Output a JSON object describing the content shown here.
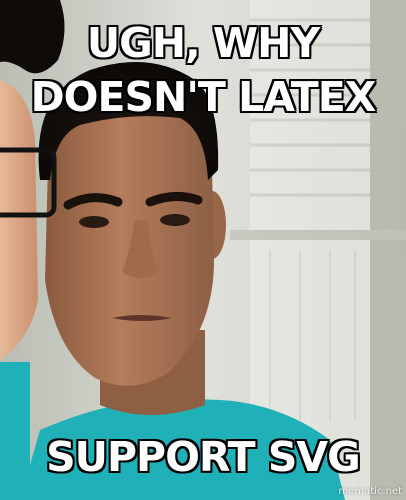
{
  "meme": {
    "top_text_line1": "UGH, WHY",
    "top_text_line2": "DOESN'T LATEX",
    "bottom_text": "SUPPORT SVG",
    "watermark": "mematic.net"
  },
  "colors": {
    "caption_fill": "#ffffff",
    "caption_outline": "#000000",
    "shirt": "#1fb0b8",
    "background_window": "#d9dcd6"
  }
}
